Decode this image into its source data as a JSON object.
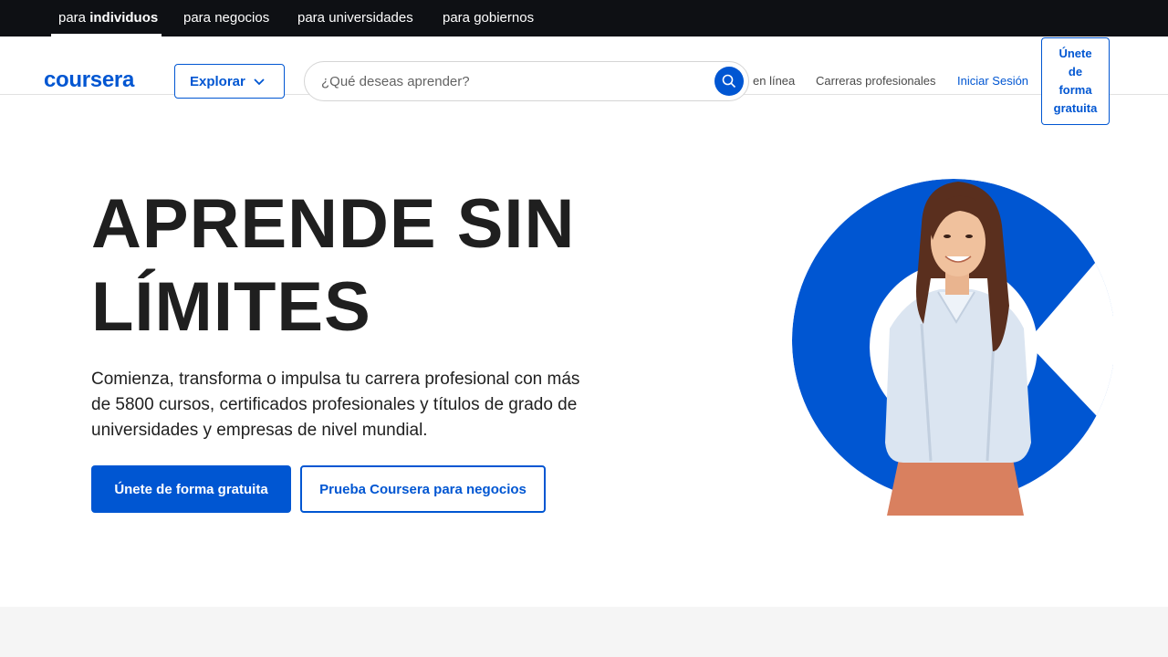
{
  "audience_nav": [
    {
      "prefix": "para ",
      "strong": "individuos",
      "active": true
    },
    {
      "prefix": "para negocios",
      "strong": "",
      "active": false
    },
    {
      "prefix": "para universidades",
      "strong": "",
      "active": false
    },
    {
      "prefix": "para gobiernos",
      "strong": "",
      "active": false
    }
  ],
  "header": {
    "logo": "coursera",
    "explore_label": "Explorar",
    "search_placeholder": "¿Qué deseas aprender?",
    "links": {
      "online": "en línea",
      "careers": "Carreras profesionales",
      "login": "Iniciar Sesión"
    },
    "join_lines": [
      "Únete",
      "de",
      "forma",
      "gratuita"
    ]
  },
  "hero": {
    "title_lines": [
      "APRENDE SIN",
      "LÍMITES"
    ],
    "description": "Comienza, transforma o impulsa tu carrera profesional con más de 5800 cursos, certificados profesionales y títulos de grado de universidades y empresas de nivel mundial.",
    "primary_cta": "Únete de forma gratuita",
    "secondary_cta": "Prueba Coursera para negocios"
  },
  "colors": {
    "brand": "#0056d2",
    "topbar": "#0e1014",
    "text": "#1f1f1f"
  }
}
